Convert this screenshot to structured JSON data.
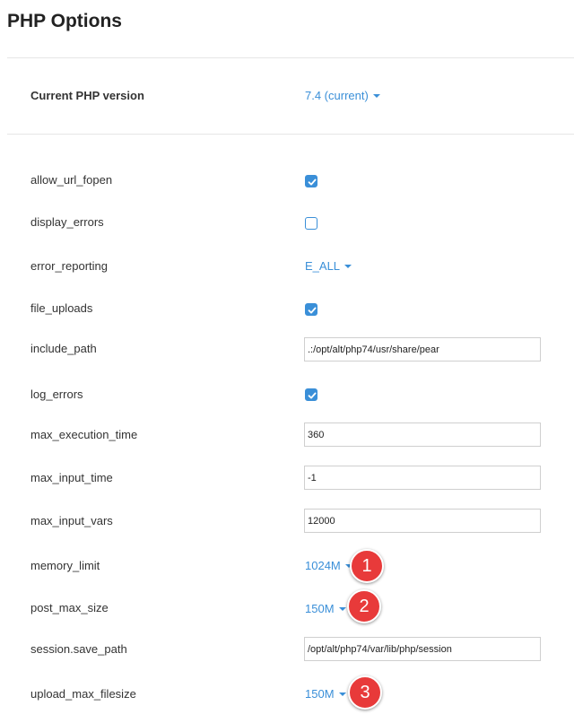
{
  "page": {
    "title": "PHP Options"
  },
  "version": {
    "label": "Current PHP version",
    "value": "7.4 (current)"
  },
  "options": [
    {
      "label": "allow_url_fopen",
      "type": "checkbox",
      "checked": true
    },
    {
      "label": "display_errors",
      "type": "checkbox",
      "checked": false
    },
    {
      "label": "error_reporting",
      "type": "dropdown",
      "value": "E_ALL"
    },
    {
      "label": "file_uploads",
      "type": "checkbox",
      "checked": true
    },
    {
      "label": "include_path",
      "type": "text",
      "value": ".:/opt/alt/php74/usr/share/pear"
    },
    {
      "label": "log_errors",
      "type": "checkbox",
      "checked": true
    },
    {
      "label": "max_execution_time",
      "type": "text",
      "value": "360"
    },
    {
      "label": "max_input_time",
      "type": "text",
      "value": "-1"
    },
    {
      "label": "max_input_vars",
      "type": "text",
      "value": "12000"
    },
    {
      "label": "memory_limit",
      "type": "dropdown",
      "value": "1024M",
      "annotation": "1"
    },
    {
      "label": "post_max_size",
      "type": "dropdown",
      "value": "150M",
      "annotation": "2"
    },
    {
      "label": "session.save_path",
      "type": "text",
      "value": "/opt/alt/php74/var/lib/php/session"
    },
    {
      "label": "upload_max_filesize",
      "type": "dropdown",
      "value": "150M",
      "annotation": "3"
    }
  ],
  "colors": {
    "accent": "#3a8fd8",
    "badge": "#e83a3a",
    "divider": "#e6e6e6"
  }
}
